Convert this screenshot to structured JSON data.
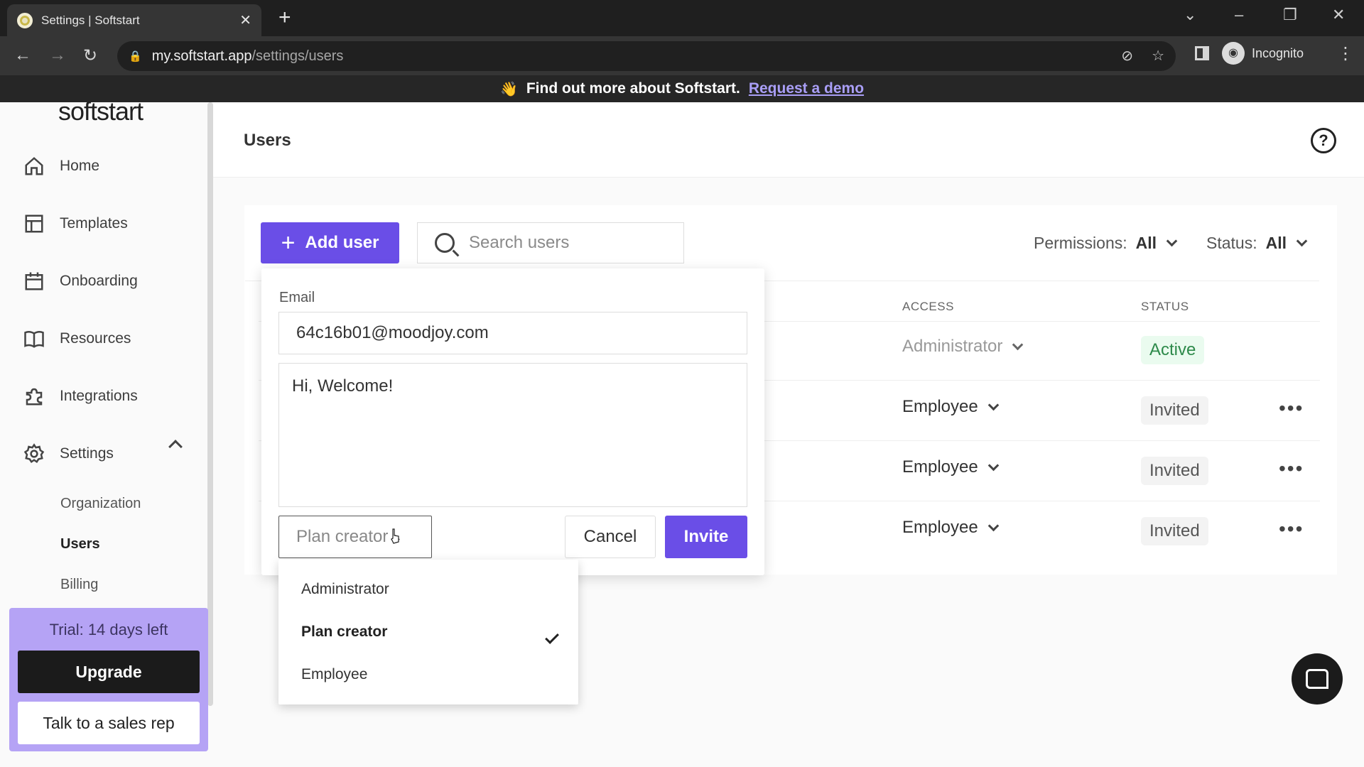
{
  "browser": {
    "tab_title": "Settings | Softstart",
    "tab_close": "✕",
    "new_tab": "+",
    "url_host": "my.softstart.app",
    "url_path": "/settings/users",
    "profile_label": "Incognito"
  },
  "banner": {
    "emoji": "👋",
    "text": "Find out more about Softstart.",
    "link": "Request a demo"
  },
  "sidebar": {
    "logo": "softstart",
    "items": [
      {
        "label": "Home",
        "icon": "home-icon"
      },
      {
        "label": "Templates",
        "icon": "layout-icon"
      },
      {
        "label": "Onboarding",
        "icon": "calendar-icon"
      },
      {
        "label": "Resources",
        "icon": "book-icon"
      },
      {
        "label": "Integrations",
        "icon": "puzzle-icon"
      },
      {
        "label": "Settings",
        "icon": "gear-icon"
      }
    ],
    "subitems": [
      "Organization",
      "Users",
      "Billing"
    ],
    "active_subitem": "Users",
    "trial_text": "Trial: 14 days left",
    "upgrade_label": "Upgrade",
    "sales_label": "Talk to a sales rep"
  },
  "main": {
    "title": "Users",
    "help": "?",
    "add_user_label": "Add user",
    "search_placeholder": "Search users",
    "permissions_label": "Permissions:",
    "permissions_value": "All",
    "status_label": "Status:",
    "status_value": "All",
    "columns": {
      "access": "ACCESS",
      "status": "STATUS"
    },
    "rows": [
      {
        "access": "Administrator",
        "status": "Active"
      },
      {
        "access": "Employee",
        "status": "Invited"
      },
      {
        "access": "Employee",
        "status": "Invited"
      },
      {
        "access": "Employee",
        "status": "Invited"
      }
    ],
    "more": "•••"
  },
  "invite_form": {
    "email_label": "Email",
    "email_value": "64c16b01@moodjoy.com",
    "message_value": "Hi, Welcome!",
    "role_value": "Plan creator",
    "cancel_label": "Cancel",
    "invite_label": "Invite"
  },
  "role_dropdown": {
    "options": [
      "Administrator",
      "Plan creator",
      "Employee"
    ],
    "selected": "Plan creator"
  },
  "colors": {
    "accent": "#6a4ee7",
    "trial_bg": "#b5a3f5",
    "banner_link": "#a99ef6",
    "active_status": "#2d8a4a"
  }
}
